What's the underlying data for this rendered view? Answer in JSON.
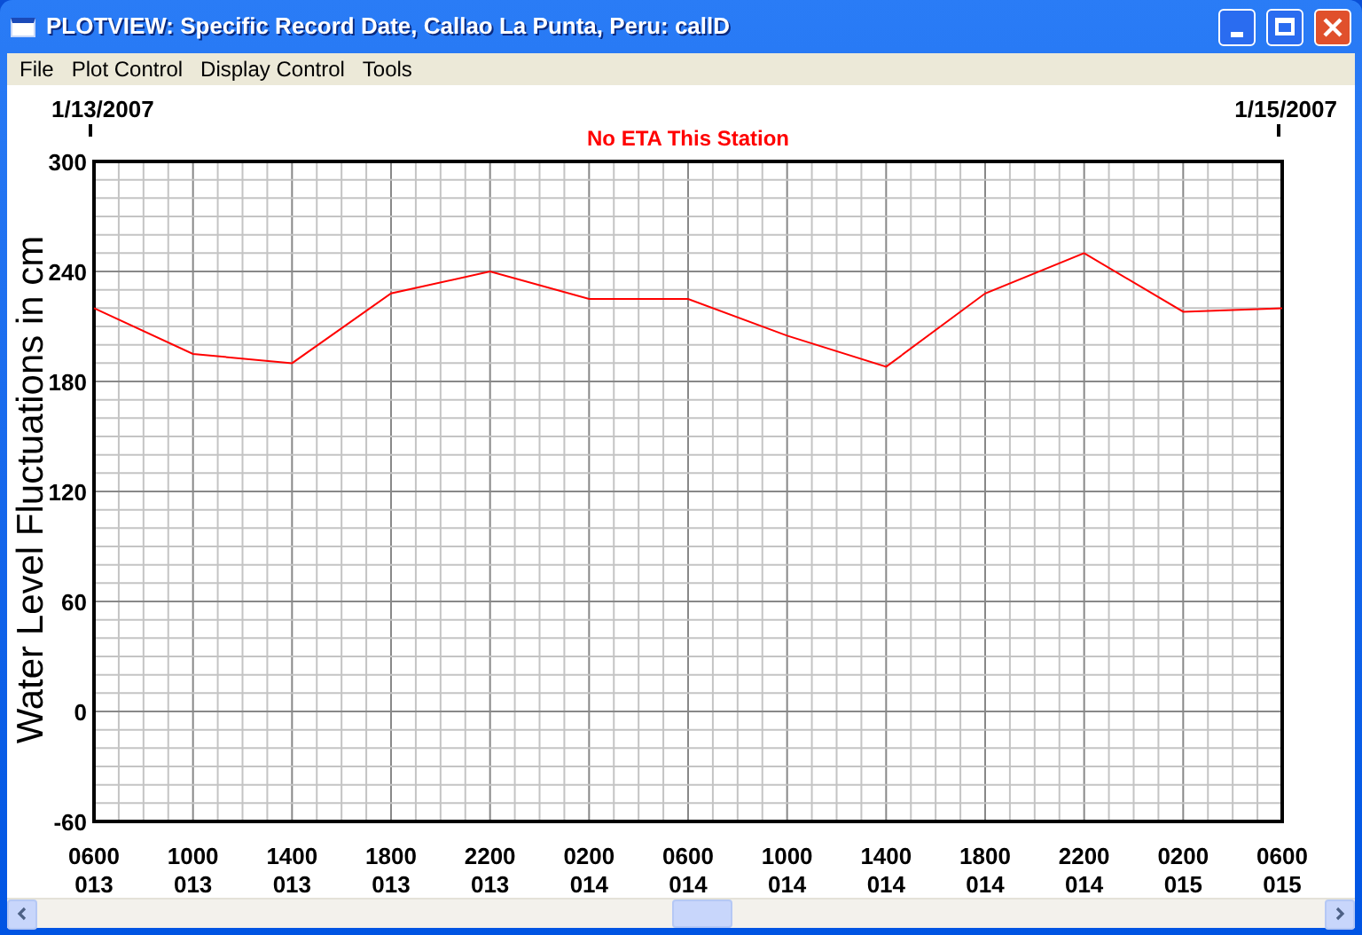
{
  "window": {
    "title": "PLOTVIEW: Specific Record Date, Callao La Punta, Peru: callD"
  },
  "menu": [
    "File",
    "Plot Control",
    "Display Control",
    "Tools"
  ],
  "date_markers": [
    "1/13/2007",
    "1/15/2007"
  ],
  "chart_data": {
    "type": "line",
    "title": "No ETA This Station",
    "ylabel": "Water Level Fluctuations in cm",
    "categories": [
      "0600 013",
      "1000 013",
      "1400 013",
      "1800 013",
      "2200 013",
      "0200 014",
      "0600 014",
      "1000 014",
      "1400 014",
      "1800 014",
      "2200 014",
      "0200 015",
      "0600 015"
    ],
    "series": [
      {
        "color": "#ff0000",
        "values": [
          220,
          195,
          190,
          228,
          240,
          225,
          225,
          205,
          188,
          228,
          250,
          218,
          220
        ]
      }
    ],
    "ylim": [
      -60,
      300
    ],
    "grid": true,
    "yticks": [
      300,
      240,
      180,
      120,
      60,
      0,
      -60
    ]
  }
}
